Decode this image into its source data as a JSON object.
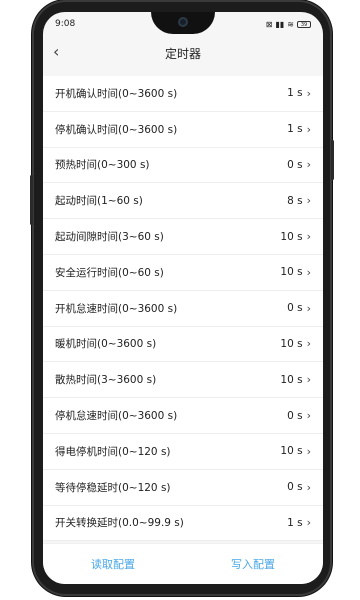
{
  "status_bar": {
    "time": "9:08",
    "battery": "39"
  },
  "header": {
    "title": "定时器",
    "back_icon": "chevron-left-icon"
  },
  "rows": [
    {
      "label": "开机确认时间(0~3600 s)",
      "value": "1 s"
    },
    {
      "label": "停机确认时间(0~3600 s)",
      "value": "1 s"
    },
    {
      "label": "预热时间(0~300 s)",
      "value": "0 s"
    },
    {
      "label": "起动时间(1~60 s)",
      "value": "8 s"
    },
    {
      "label": "起动间隙时间(3~60 s)",
      "value": "10 s"
    },
    {
      "label": "安全运行时间(0~60 s)",
      "value": "10 s"
    },
    {
      "label": "开机怠速时间(0~3600 s)",
      "value": "0 s"
    },
    {
      "label": "暖机时间(0~3600 s)",
      "value": "10 s"
    },
    {
      "label": "散热时间(3~3600 s)",
      "value": "10 s"
    },
    {
      "label": "停机怠速时间(0~3600 s)",
      "value": "0 s"
    },
    {
      "label": "得电停机时间(0~120 s)",
      "value": "10 s"
    },
    {
      "label": "等待停稳延时(0~120 s)",
      "value": "0 s"
    },
    {
      "label": "开关转换延时(0.0~99.9 s)",
      "value": "1 s"
    }
  ],
  "footer": {
    "read_label": "读取配置",
    "write_label": "写入配置",
    "accent": "#48a7e8"
  }
}
